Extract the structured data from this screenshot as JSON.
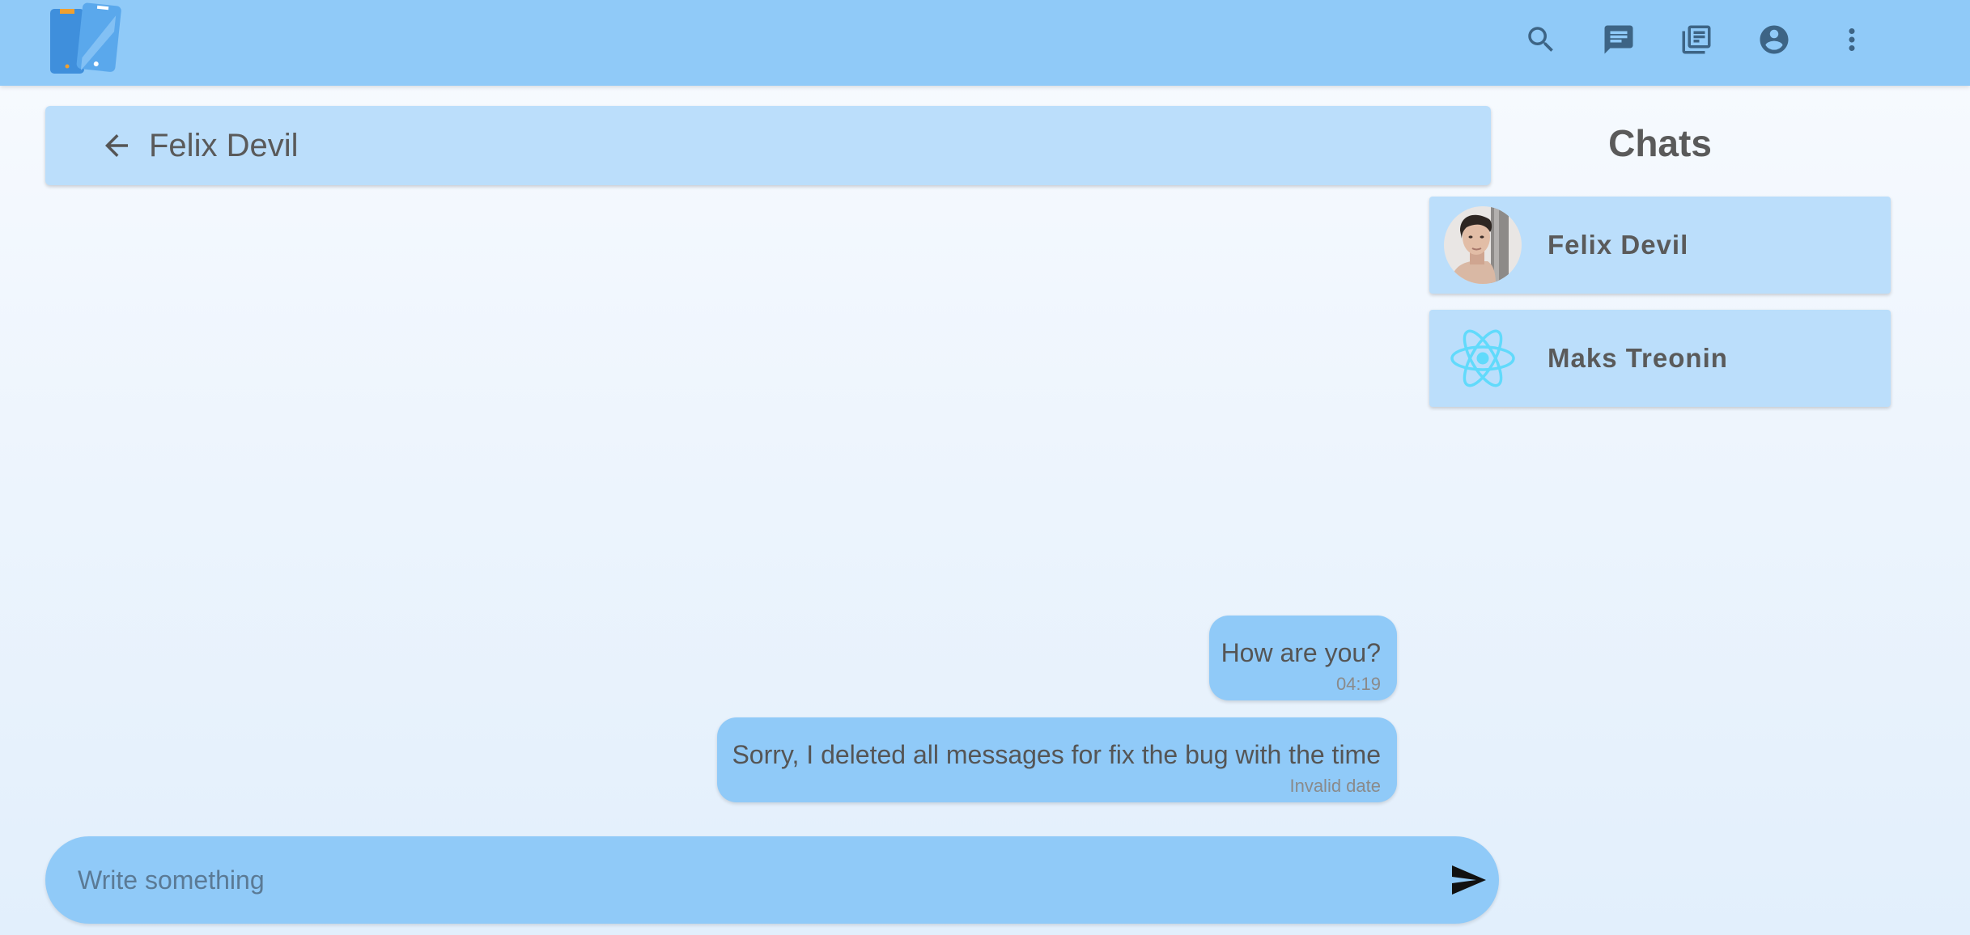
{
  "appbar": {
    "color": "#90caf8",
    "icons": [
      {
        "name": "search-icon"
      },
      {
        "name": "chat-icon"
      },
      {
        "name": "library-books-icon"
      },
      {
        "name": "account-circle-icon"
      },
      {
        "name": "more-vert-icon"
      }
    ]
  },
  "chat": {
    "title": "Felix Devil",
    "messages": [
      {
        "text": "How are you?",
        "time": "04:19"
      },
      {
        "text": "Sorry, I deleted all messages for fix the bug with the time",
        "time": "Invalid date"
      }
    ]
  },
  "sidebar": {
    "title": "Chats",
    "items": [
      {
        "name": "Felix Devil",
        "avatar": "person-photo"
      },
      {
        "name": "Maks Treonin",
        "avatar": "react-logo-icon"
      }
    ]
  },
  "composer": {
    "placeholder": "Write something"
  },
  "colors": {
    "accent": "#90caf8",
    "panel": "#bbdefb",
    "react": "#61dafb"
  }
}
